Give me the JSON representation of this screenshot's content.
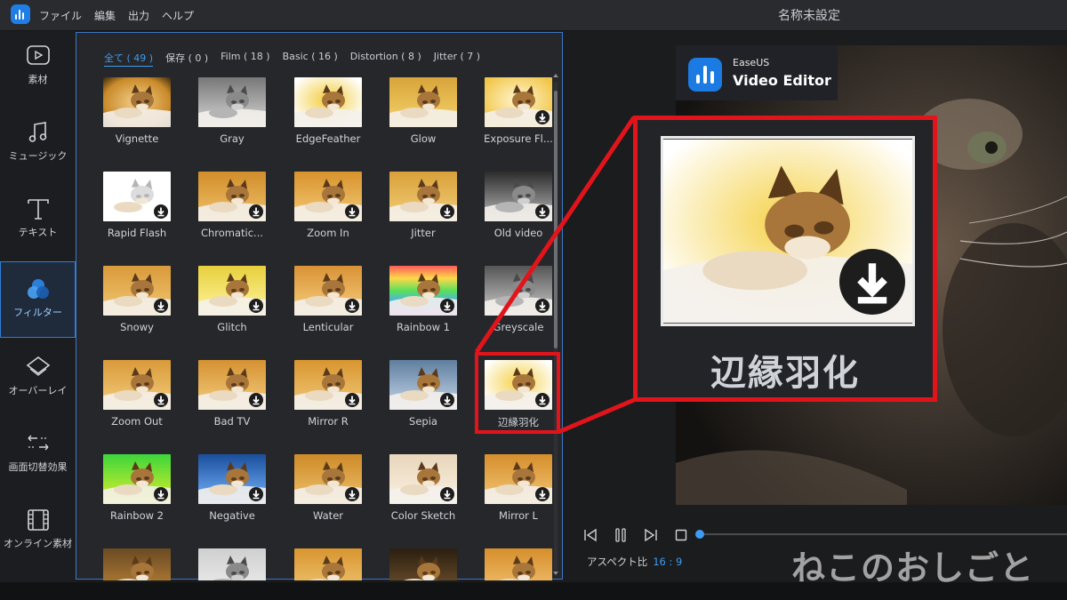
{
  "window": {
    "title": "名称未設定",
    "menu": [
      "ファイル",
      "編集",
      "出力",
      "ヘルプ"
    ]
  },
  "sidebar": {
    "items": [
      {
        "label": "素材",
        "icon": "media-play-icon"
      },
      {
        "label": "ミュージック",
        "icon": "music-note-icon"
      },
      {
        "label": "テキスト",
        "icon": "text-T-icon"
      },
      {
        "label": "フィルター",
        "icon": "filter-circles-icon",
        "active": true
      },
      {
        "label": "オーバーレイ",
        "icon": "overlay-layers-icon"
      },
      {
        "label": "画面切替効果",
        "icon": "transition-arrows-icon"
      },
      {
        "label": "オンライン素材",
        "icon": "film-icon"
      }
    ]
  },
  "filters": {
    "tabs": [
      "全て ( 49 )",
      "保存 ( 0 )",
      "Film ( 18 )",
      "Basic ( 16 )",
      "Distortion ( 8 )",
      "Jitter ( 7 )"
    ],
    "active_tab": 0,
    "items": [
      {
        "label": "Vignette",
        "download": false
      },
      {
        "label": "Gray",
        "download": false
      },
      {
        "label": "EdgeFeather",
        "download": false
      },
      {
        "label": "Glow",
        "download": false
      },
      {
        "label": "Exposure Fl...",
        "download": true
      },
      {
        "label": "Rapid Flash",
        "download": true
      },
      {
        "label": "Chromatic...",
        "download": true
      },
      {
        "label": "Zoom In",
        "download": true
      },
      {
        "label": "Jitter",
        "download": true
      },
      {
        "label": "Old video",
        "download": true
      },
      {
        "label": "Snowy",
        "download": true
      },
      {
        "label": "Glitch",
        "download": true
      },
      {
        "label": "Lenticular",
        "download": true
      },
      {
        "label": "Rainbow 1",
        "download": true
      },
      {
        "label": "Greyscale",
        "download": true
      },
      {
        "label": "Zoom Out",
        "download": true
      },
      {
        "label": "Bad TV",
        "download": true
      },
      {
        "label": "Mirror R",
        "download": true
      },
      {
        "label": "Sepia",
        "download": true
      },
      {
        "label": "辺縁羽化",
        "download": true,
        "highlighted": true
      },
      {
        "label": "Rainbow 2",
        "download": true
      },
      {
        "label": "Negative",
        "download": true
      },
      {
        "label": "Water",
        "download": true
      },
      {
        "label": "Color Sketch",
        "download": true
      },
      {
        "label": "Mirror L",
        "download": true
      }
    ]
  },
  "preview": {
    "brand_name": "EaseUS",
    "brand_product": "Video Editor",
    "aspect_label": "アスペクト比",
    "aspect_value": "16 : 9",
    "progress": 0
  },
  "callout": {
    "label": "辺縁羽化"
  },
  "watermark": "ねこのおしごと",
  "colors": {
    "accent": "#3d9cf2",
    "highlight": "#e2141b"
  }
}
